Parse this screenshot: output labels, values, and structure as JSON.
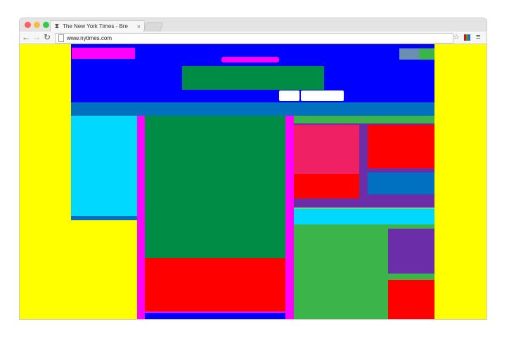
{
  "tab": {
    "favicon": "𝕿",
    "title": "The New York Times - Bre",
    "close": "×"
  },
  "toolbar": {
    "back": "←",
    "forward": "→",
    "reload": "↻",
    "url": "www.nytimes.com",
    "star": "☆",
    "menu": "≡"
  },
  "icons": {
    "back": "back-arrow-icon",
    "forward": "forward-arrow-icon",
    "reload": "reload-icon",
    "page": "page-icon",
    "star": "bookmark-star-icon",
    "extension": "extension-icon",
    "menu": "hamburger-menu-icon"
  },
  "colors": {
    "background": "#ffff00",
    "masthead": "#0000ff",
    "logo": "#008c45",
    "nav": "#0070c0",
    "magenta": "#ff00ff",
    "cyan": "#00d8ff",
    "green": "#3bb54a",
    "red": "#ff0000",
    "pink": "#ef2063",
    "purple": "#6b2ea8",
    "steel": "#6a8fb0",
    "white": "#ffffff"
  }
}
